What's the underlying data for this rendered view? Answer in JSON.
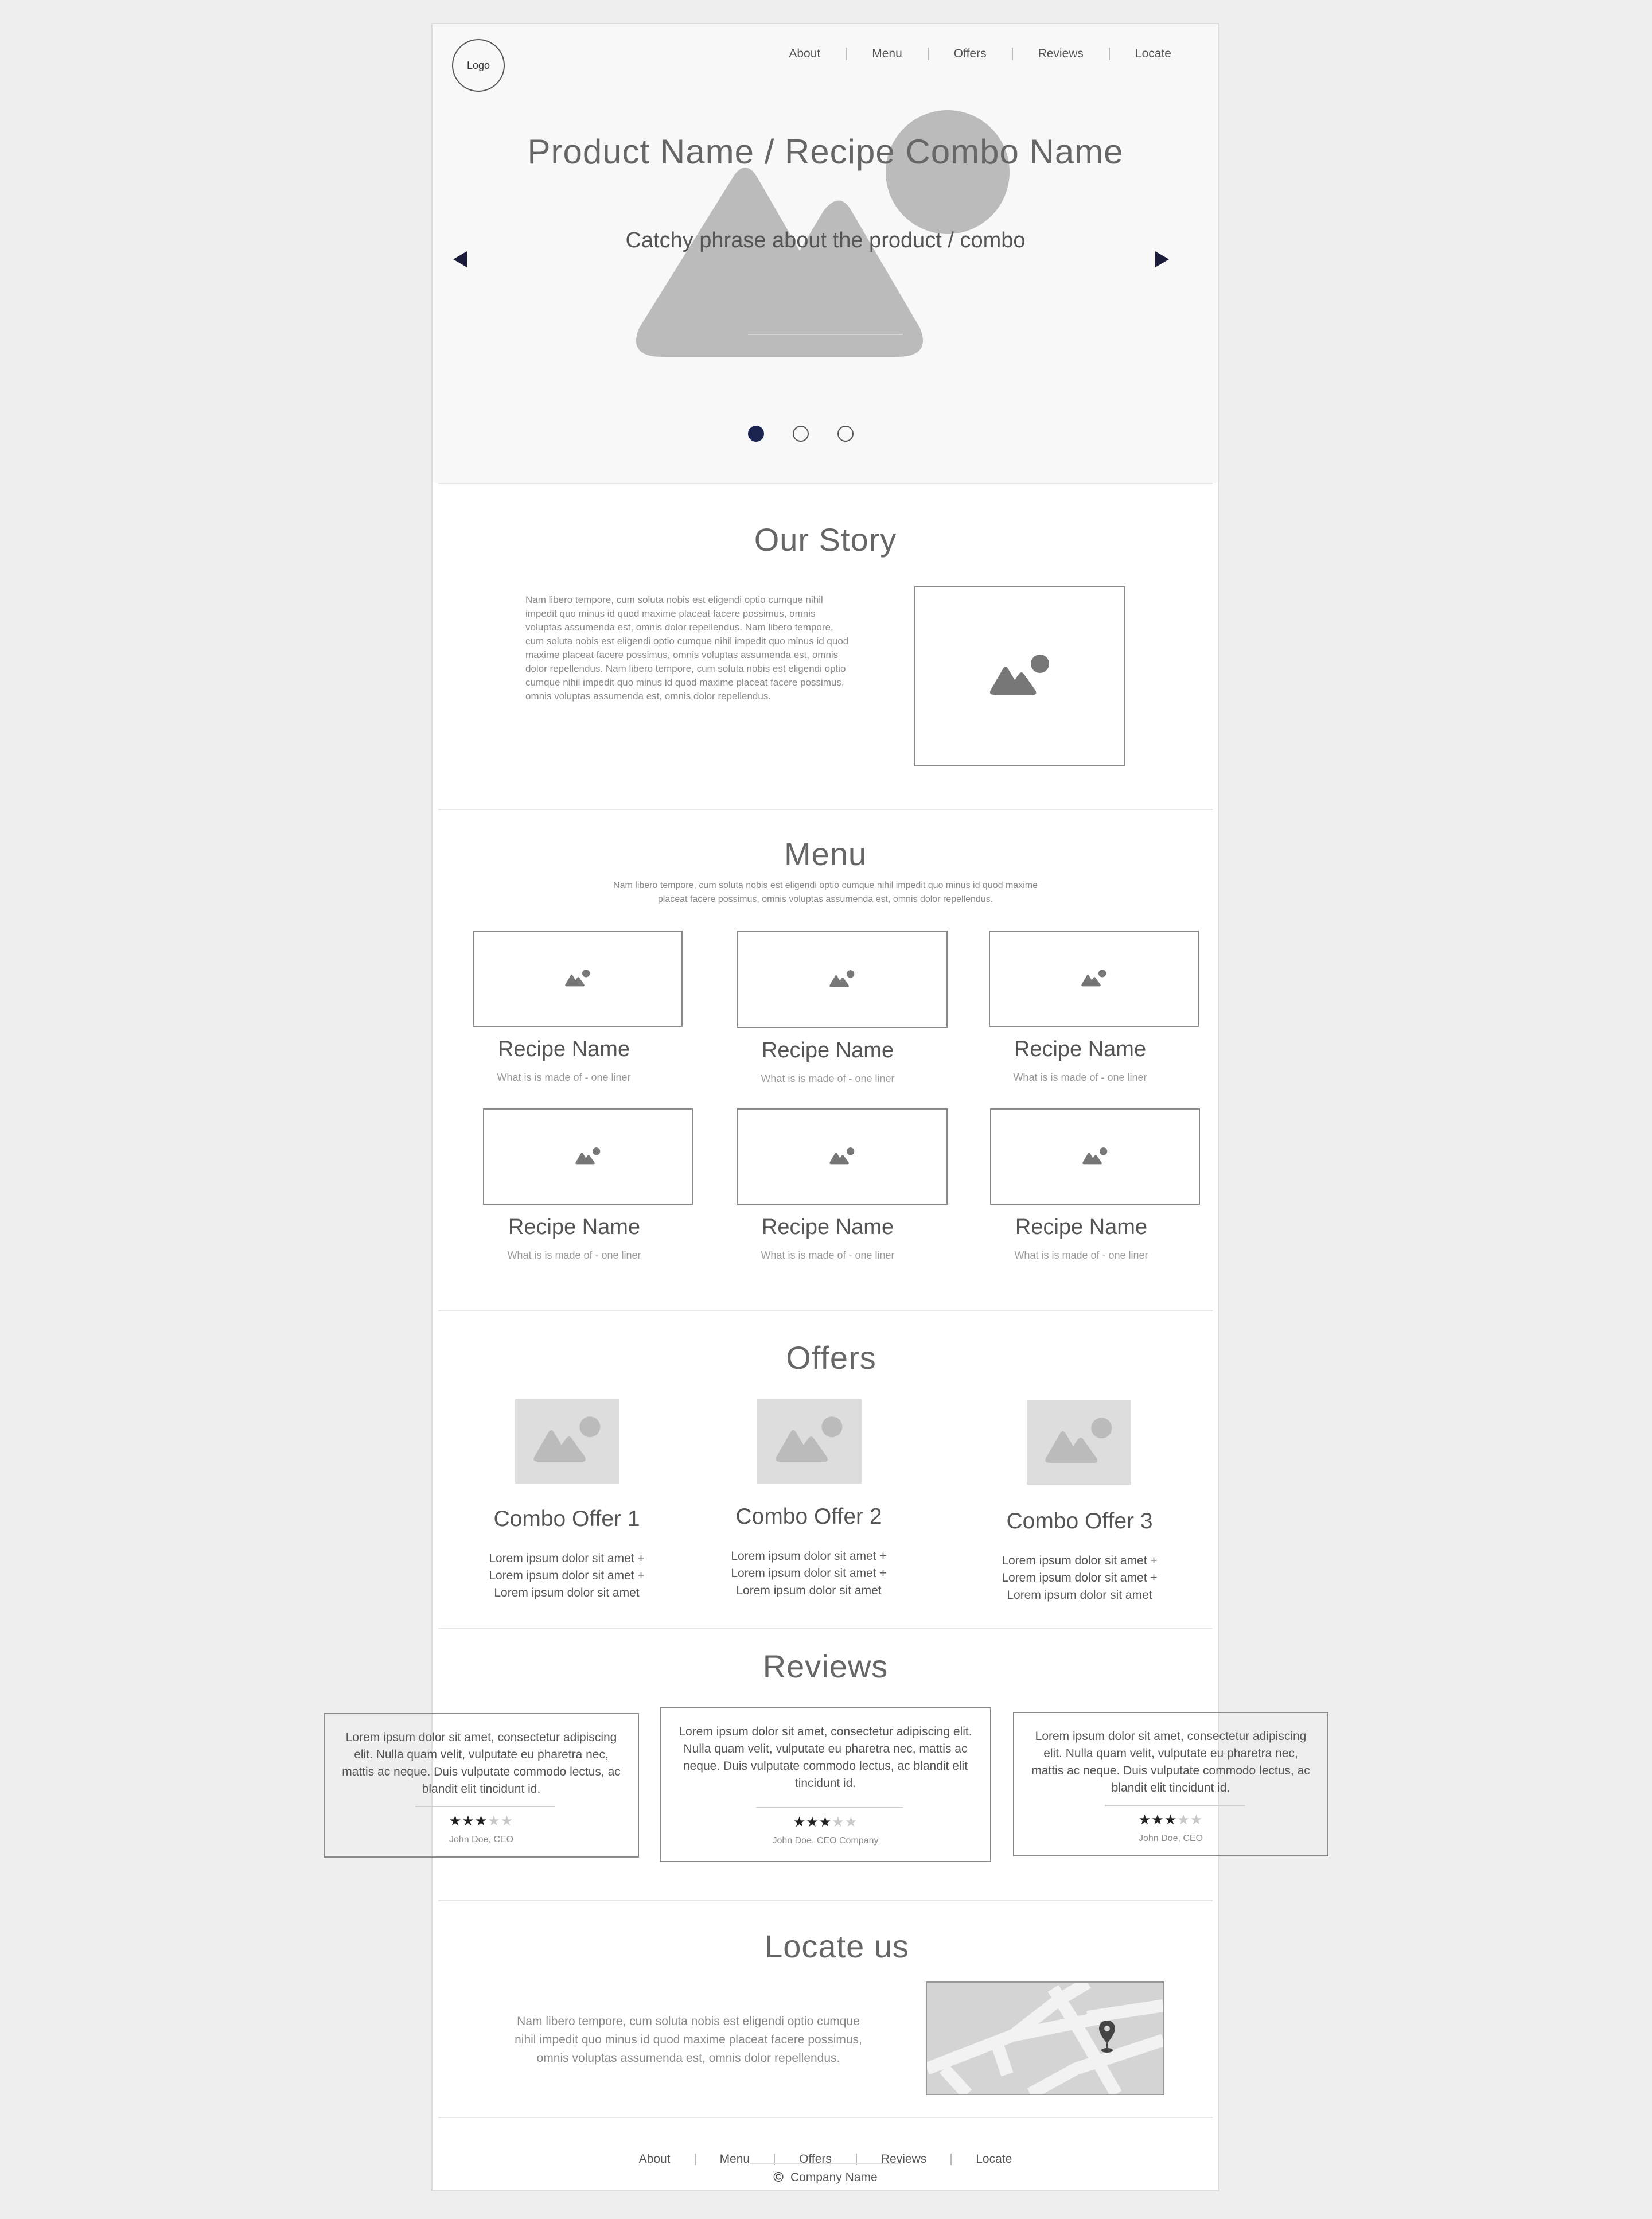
{
  "header": {
    "logo": "Logo",
    "nav": [
      "About",
      "Menu",
      "Offers",
      "Reviews",
      "Locate"
    ]
  },
  "hero": {
    "title": "Product Name / Recipe Combo Name",
    "subtitle": "Catchy phrase about the product / combo",
    "slides_total": 3,
    "active_slide": 1,
    "icons": {
      "prev": "arrow-left-icon",
      "next": "arrow-right-icon",
      "image": "image-placeholder-icon"
    }
  },
  "story": {
    "title": "Our Story",
    "text": "Nam libero tempore, cum soluta nobis est eligendi optio cumque nihil impedit quo minus id quod maxime placeat facere possimus, omnis voluptas assumenda est, omnis dolor repellendus.  Nam libero tempore, cum soluta nobis est eligendi optio cumque nihil impedit quo minus id quod maxime placeat facere possimus, omnis voluptas assumenda est, omnis dolor repellendus.  Nam libero tempore, cum soluta nobis est eligendi optio cumque nihil impedit quo minus id quod maxime placeat facere possimus, omnis voluptas assumenda est, omnis dolor repellendus."
  },
  "menu": {
    "title": "Menu",
    "intro": "Nam libero tempore, cum soluta nobis est eligendi optio cumque nihil impedit quo minus id quod maxime placeat facere possimus, omnis voluptas assumenda est, omnis dolor repellendus.",
    "items": [
      {
        "name": "Recipe Name",
        "desc": "What is is made of - one liner"
      },
      {
        "name": "Recipe Name",
        "desc": "What is is made of - one liner"
      },
      {
        "name": "Recipe Name",
        "desc": "What is is made of - one liner"
      },
      {
        "name": "Recipe Name",
        "desc": "What is is made of - one liner"
      },
      {
        "name": "Recipe Name",
        "desc": "What is is made of - one liner"
      },
      {
        "name": "Recipe Name",
        "desc": "What is is made of - one liner"
      }
    ]
  },
  "offers": {
    "title": "Offers",
    "items": [
      {
        "name": "Combo Offer 1",
        "lines": [
          "Lorem ipsum dolor sit amet +",
          "Lorem ipsum dolor sit amet +",
          "Lorem ipsum dolor sit amet"
        ]
      },
      {
        "name": "Combo Offer 2",
        "lines": [
          "Lorem ipsum dolor sit amet +",
          "Lorem ipsum dolor sit amet +",
          "Lorem ipsum dolor sit amet"
        ]
      },
      {
        "name": "Combo Offer 3",
        "lines": [
          "Lorem ipsum dolor sit amet +",
          "Lorem ipsum dolor sit amet +",
          "Lorem ipsum dolor sit amet"
        ]
      }
    ]
  },
  "reviews": {
    "title": "Reviews",
    "items": [
      {
        "text": "Lorem ipsum dolor sit amet, consectetur adipiscing elit. Nulla quam velit, vulputate eu pharetra nec, mattis ac neque. Duis vulputate commodo lectus, ac blandit elit tincidunt id.",
        "stars": 3,
        "max_stars": 5,
        "author": "John Doe, CEO"
      },
      {
        "text": "Lorem ipsum dolor sit amet, consectetur adipiscing elit. Nulla quam velit, vulputate eu pharetra nec, mattis ac neque. Duis vulputate commodo lectus, ac blandit elit tincidunt id.",
        "stars": 3,
        "max_stars": 5,
        "author": "John Doe, CEO Company"
      },
      {
        "text": "Lorem ipsum dolor sit amet, consectetur adipiscing elit. Nulla quam velit, vulputate eu pharetra nec, mattis ac neque. Duis vulputate commodo lectus, ac blandit elit tincidunt id.",
        "stars": 3,
        "max_stars": 5,
        "author": "John Doe, CEO"
      }
    ]
  },
  "locate": {
    "title": "Locate us",
    "text": "Nam libero tempore, cum soluta nobis est eligendi optio cumque nihil impedit quo minus id quod maxime placeat facere possimus, omnis voluptas assumenda est, omnis dolor repellendus.",
    "icons": {
      "map": "map-icon",
      "pin": "map-pin-icon"
    }
  },
  "footer": {
    "nav": [
      "About",
      "Menu",
      "Offers",
      "Reviews",
      "Locate"
    ],
    "copyright_symbol": "©",
    "company": "Company Name"
  },
  "colors": {
    "accent": "#1b2450",
    "placeholder": "#bbbbbb",
    "icon": "#777777",
    "background": "#eeeeee"
  }
}
